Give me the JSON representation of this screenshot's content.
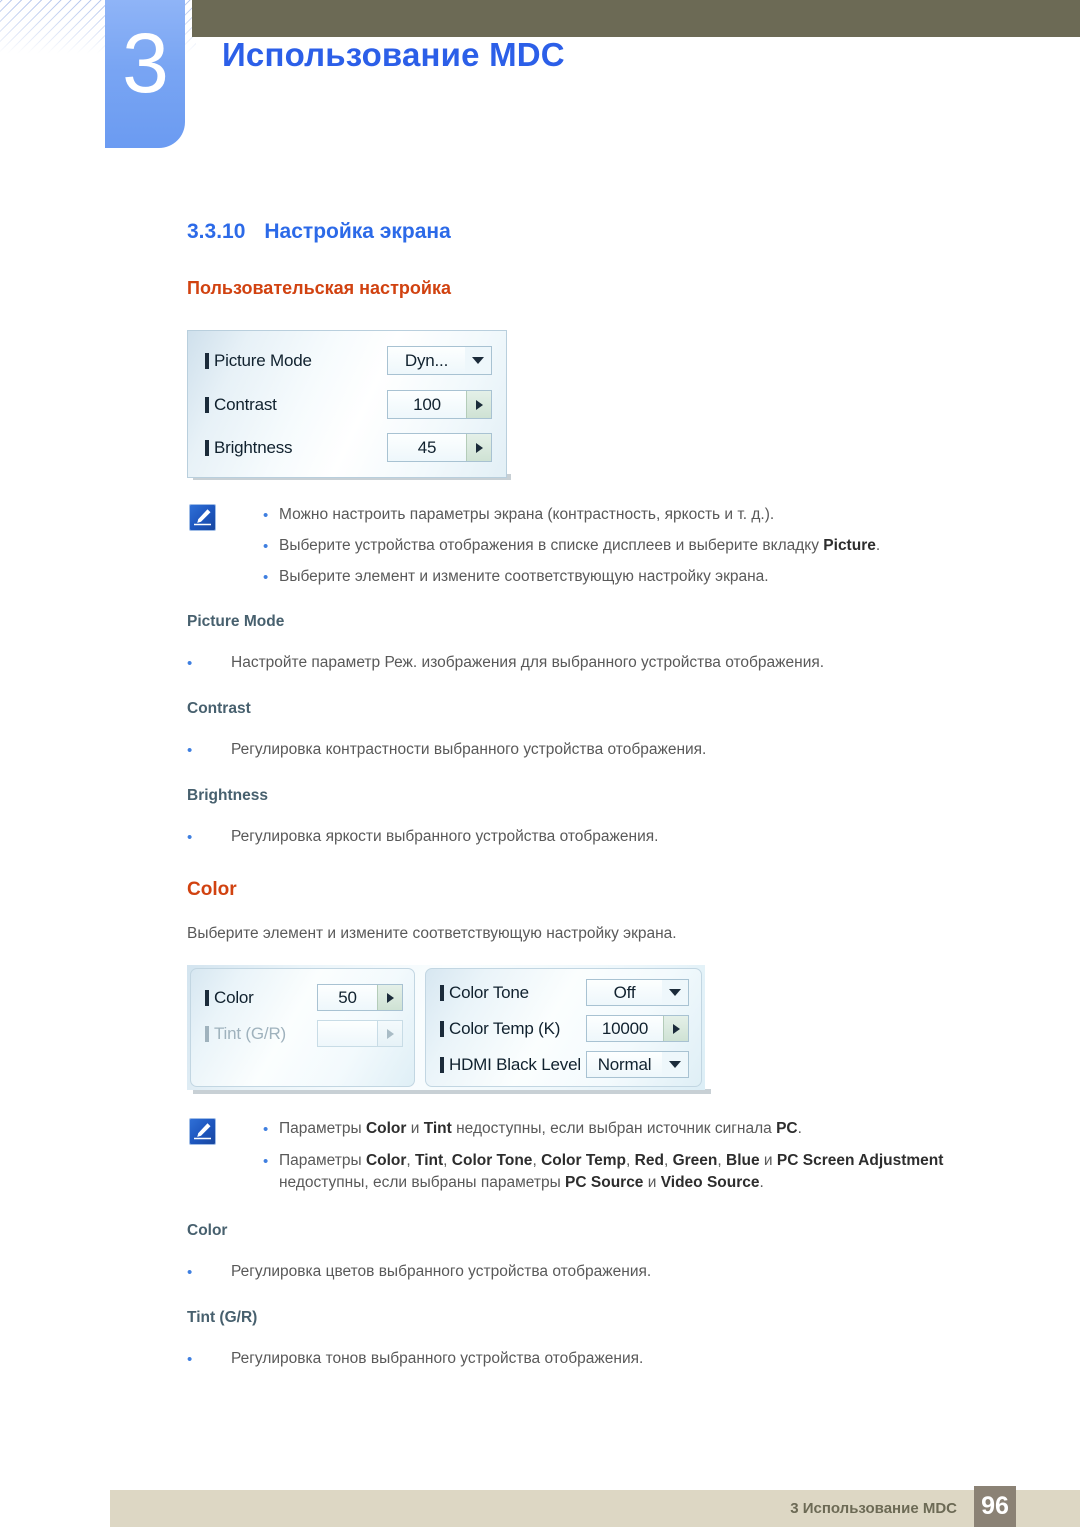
{
  "header": {
    "chapter_number": "3",
    "chapter_title": "Использование MDC"
  },
  "section": {
    "number": "3.3.10",
    "title": "Настройка экрана",
    "subtitle": "Пользовательская настройка"
  },
  "picture_panel": {
    "rows": [
      {
        "label": "Picture Mode",
        "value": "Dyn...",
        "control": "dropdown"
      },
      {
        "label": "Contrast",
        "value": "100",
        "control": "spinner"
      },
      {
        "label": "Brightness",
        "value": "45",
        "control": "spinner"
      }
    ]
  },
  "note1": {
    "icon": "note-pencil-icon",
    "bullets": [
      "Можно настроить параметры экрана (контрастность, яркость и т. д.).",
      "Выберите устройства отображения в списке дисплеев и выберите вкладку <b>Picture</b>.",
      "Выберите элемент и измените соответствующую настройку экрана."
    ]
  },
  "picture_mode": {
    "heading": "Picture Mode",
    "bullet": "Настройте параметр Реж. изображения для выбранного устройства отображения."
  },
  "contrast": {
    "heading": "Contrast",
    "bullet": "Регулировка контрастности выбранного устройства отображения."
  },
  "brightness": {
    "heading": "Brightness",
    "bullet": "Регулировка яркости выбранного устройства отображения."
  },
  "color_section": {
    "heading": "Color",
    "intro": "Выберите элемент и измените соответствующую настройку экрана."
  },
  "color_panel": {
    "left_rows": [
      {
        "label": "Color",
        "value": "50",
        "control": "spinner",
        "disabled": false
      },
      {
        "label": "Tint (G/R)",
        "value": "",
        "control": "spinner",
        "disabled": true
      }
    ],
    "right_rows": [
      {
        "label": "Color Tone",
        "value": "Off",
        "control": "dropdown",
        "disabled": false
      },
      {
        "label": "Color Temp (K)",
        "value": "10000",
        "control": "spinner",
        "disabled": false
      },
      {
        "label": "HDMI Black Level",
        "value": "Normal",
        "control": "dropdown",
        "disabled": false
      }
    ]
  },
  "note2": {
    "icon": "note-pencil-icon",
    "bullets": [
      "Параметры <b>Color</b> и <b>Tint</b> недоступны, если выбран источник сигнала <b>PC</b>.",
      "Параметры <b>Color</b>, <b>Tint</b>, <b>Color Tone</b>, <b>Color Temp</b>, <b>Red</b>, <b>Green</b>, <b>Blue</b> и <b>PC Screen Adjustment</b><br>недоступны, если выбраны параметры <b>PC Source</b> и <b>Video Source</b>."
    ]
  },
  "color_detail": {
    "heading": "Color",
    "bullet": "Регулировка цветов выбранного устройства отображения."
  },
  "tint_detail": {
    "heading": "Tint (G/R)",
    "bullet": "Регулировка тонов выбранного устройства отображения."
  },
  "footer": {
    "text": "3 Использование MDC",
    "page": "96"
  },
  "colors": {
    "chapter_blue": "#2c5fe8",
    "olive": "#6c6a55",
    "orange": "#d14210",
    "slate": "#47606e",
    "body_gray": "#595959",
    "footer_bar": "#ddd7c4",
    "footer_badge": "#8b8275"
  }
}
